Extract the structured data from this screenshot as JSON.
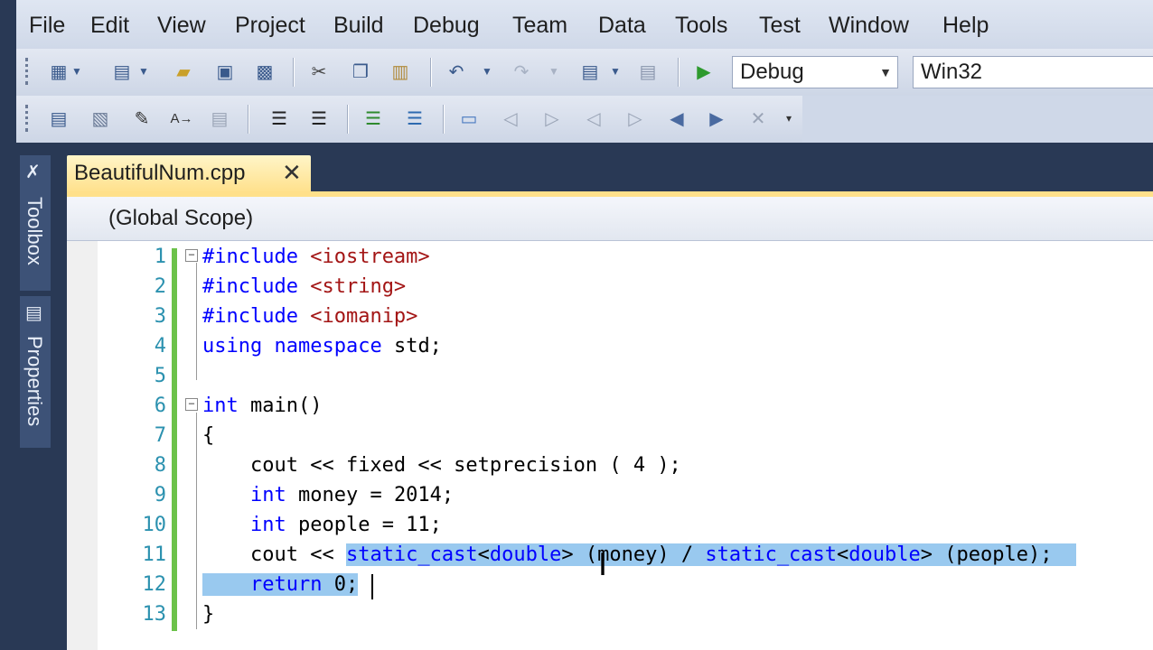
{
  "menu": [
    "File",
    "Edit",
    "View",
    "Project",
    "Build",
    "Debug",
    "Team",
    "Data",
    "Tools",
    "Test",
    "Window",
    "Help"
  ],
  "toolbar": {
    "config_value": "Debug",
    "platform_value": "Win32"
  },
  "sidebar": {
    "toolbox_label": "Toolbox",
    "properties_label": "Properties"
  },
  "document_tab": {
    "name": "BeautifulNum.cpp",
    "close_glyph": "✕"
  },
  "scope": {
    "value": "(Global Scope)"
  },
  "code": {
    "lines": [
      {
        "n": "1",
        "text": "#include <iostream>"
      },
      {
        "n": "2",
        "text": "#include <string>"
      },
      {
        "n": "3",
        "text": "#include <iomanip>"
      },
      {
        "n": "4",
        "text": "using namespace std;"
      },
      {
        "n": "5",
        "text": ""
      },
      {
        "n": "6",
        "text": "int main()"
      },
      {
        "n": "7",
        "text": "{"
      },
      {
        "n": "8",
        "text": "    cout << fixed << setprecision ( 4 );"
      },
      {
        "n": "9",
        "text": "    int money = 2014;"
      },
      {
        "n": "10",
        "text": "    int people = 11;"
      },
      {
        "n": "11",
        "text": "    cout << static_cast<double> (money) / static_cast<double> (people);"
      },
      {
        "n": "12",
        "text": "    return 0;"
      },
      {
        "n": "13",
        "text": "}"
      }
    ]
  },
  "colors": {
    "keyword": "#0000ff",
    "string": "#a31515",
    "line_number": "#2b91af",
    "selection": "#99c9ef",
    "change_bar": "#6cc24a"
  }
}
